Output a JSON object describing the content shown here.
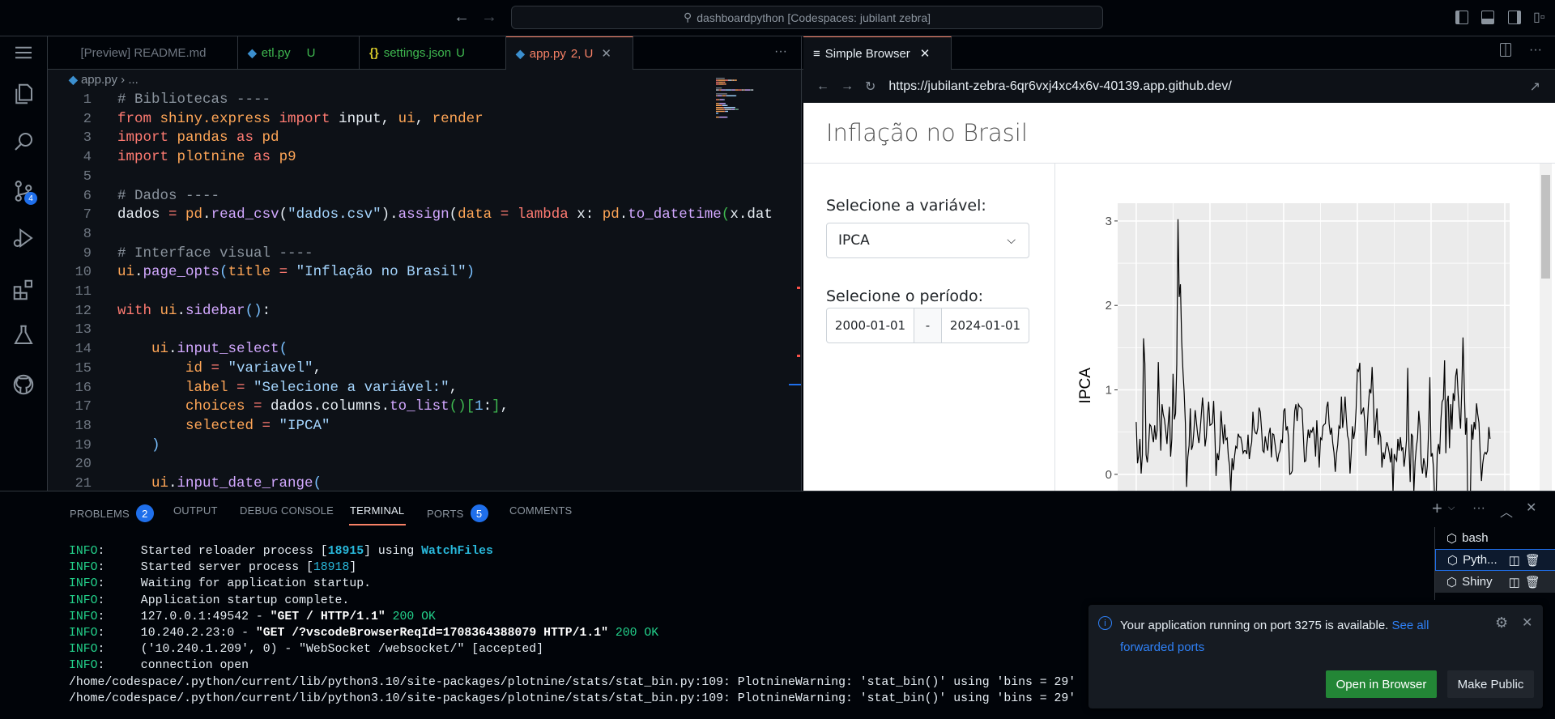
{
  "titlebar": {
    "search": "dashboardpython [Codespaces: jubilant zebra]"
  },
  "activity": {
    "source_control_badge": "4"
  },
  "tabs": [
    {
      "label": "[Preview] README.md",
      "status": ""
    },
    {
      "label": "etl.py",
      "status": "U"
    },
    {
      "label": "settings.json",
      "status": "U"
    },
    {
      "label": "app.py",
      "status": "2, U"
    }
  ],
  "tabs_more": "···",
  "breadcrumb": {
    "file": "app.py",
    "rest": "..."
  },
  "code": [
    [
      [
        "# Bibliotecas ----",
        "cm"
      ]
    ],
    [
      [
        "from",
        "kw"
      ],
      [
        " shiny.express ",
        "mo"
      ],
      [
        "import",
        "kw"
      ],
      [
        " input, ",
        "w"
      ],
      [
        "ui",
        "mo"
      ],
      [
        ", ",
        "w"
      ],
      [
        "render",
        "mo"
      ]
    ],
    [
      [
        "import",
        "kw"
      ],
      [
        " pandas ",
        "mo"
      ],
      [
        "as",
        "kw"
      ],
      [
        " pd",
        "mo"
      ]
    ],
    [
      [
        "import",
        "kw"
      ],
      [
        " plotnine ",
        "mo"
      ],
      [
        "as",
        "kw"
      ],
      [
        " p9",
        "mo"
      ]
    ],
    [],
    [
      [
        "# Dados ----",
        "cm"
      ]
    ],
    [
      [
        "dados ",
        "w"
      ],
      [
        "= ",
        "kw"
      ],
      [
        "pd",
        "mo"
      ],
      [
        ".",
        "w"
      ],
      [
        "read_csv",
        "fn"
      ],
      [
        "(",
        "w"
      ],
      [
        "\"dados.csv\"",
        "st"
      ],
      [
        ").",
        "w"
      ],
      [
        "assign",
        "fn"
      ],
      [
        "(",
        "w"
      ],
      [
        "data ",
        "mo"
      ],
      [
        "= ",
        "kw"
      ],
      [
        "lambda",
        "kw"
      ],
      [
        " x: ",
        "w"
      ],
      [
        "pd",
        "mo"
      ],
      [
        ".",
        "w"
      ],
      [
        "to_datetime",
        "fn"
      ],
      [
        "(",
        "gr"
      ],
      [
        "x.dat",
        "w"
      ]
    ],
    [],
    [
      [
        "# Interface visual ----",
        "cm"
      ]
    ],
    [
      [
        "ui",
        "mo"
      ],
      [
        ".",
        "w"
      ],
      [
        "page_opts",
        "fn"
      ],
      [
        "(",
        "bl"
      ],
      [
        "title ",
        "mo"
      ],
      [
        "= ",
        "kw"
      ],
      [
        "\"Inflação no Brasil\"",
        "st"
      ],
      [
        ")",
        "bl"
      ]
    ],
    [],
    [
      [
        "with",
        "kw"
      ],
      [
        " ui",
        "mo"
      ],
      [
        ".",
        "w"
      ],
      [
        "sidebar",
        "fn"
      ],
      [
        "()",
        "bl"
      ],
      [
        ":",
        "w"
      ]
    ],
    [],
    [
      [
        "    ui",
        "mo"
      ],
      [
        ".",
        "w"
      ],
      [
        "input_select",
        "fn"
      ],
      [
        "(",
        "bl"
      ]
    ],
    [
      [
        "        id ",
        "mo"
      ],
      [
        "= ",
        "kw"
      ],
      [
        "\"variavel\"",
        "st"
      ],
      [
        ",",
        "w"
      ]
    ],
    [
      [
        "        label ",
        "mo"
      ],
      [
        "= ",
        "kw"
      ],
      [
        "\"Selecione a variável:\"",
        "st"
      ],
      [
        ",",
        "w"
      ]
    ],
    [
      [
        "        choices ",
        "mo"
      ],
      [
        "= ",
        "kw"
      ],
      [
        "dados.columns.",
        "w"
      ],
      [
        "to_list",
        "fn"
      ],
      [
        "()",
        "gr"
      ],
      [
        "[",
        "gr"
      ],
      [
        "1",
        "bl"
      ],
      [
        ":",
        "w"
      ],
      [
        "]",
        "gr"
      ],
      [
        ",",
        "w"
      ]
    ],
    [
      [
        "        selected ",
        "mo"
      ],
      [
        "= ",
        "kw"
      ],
      [
        "\"IPCA\"",
        "st"
      ]
    ],
    [
      [
        "    )",
        "bl"
      ]
    ],
    [],
    [
      [
        "    ui",
        "mo"
      ],
      [
        ".",
        "w"
      ],
      [
        "input_date_range",
        "fn"
      ],
      [
        "(",
        "bl"
      ]
    ]
  ],
  "browser": {
    "tab_label": "Simple Browser",
    "url": "https://jubilant-zebra-6qr6vxj4xc4x6v-40139.app.github.dev/",
    "page_title": "Inflação no Brasil",
    "select_label": "Selecione a variável:",
    "select_value": "IPCA",
    "period_label": "Selecione o período:",
    "date_start": "2000-01-01",
    "date_sep": "-",
    "date_end": "2024-01-01"
  },
  "chart_data": {
    "type": "line",
    "title": "",
    "xlabel": "",
    "ylabel": "IPCA",
    "x_start": "2000-01",
    "x_step": "month",
    "xlim": [
      1998.74,
      2025.33
    ],
    "ylim": [
      -0.85,
      3.21
    ],
    "yticks": [
      0,
      1,
      2,
      3
    ],
    "ytick_labels": [
      "0",
      "1",
      "2",
      "3"
    ],
    "grid": true,
    "values": [
      0.62,
      0.13,
      0.22,
      0.42,
      0.01,
      0.23,
      1.61,
      1.31,
      0.23,
      0.14,
      0.32,
      0.59,
      0.57,
      0.46,
      0.38,
      0.58,
      0.41,
      0.52,
      1.33,
      0.7,
      0.28,
      0.83,
      0.71,
      0.65,
      0.52,
      0.36,
      0.6,
      0.8,
      0.21,
      0.42,
      1.19,
      0.65,
      0.72,
      1.31,
      3.02,
      2.1,
      2.25,
      1.57,
      1.23,
      0.97,
      0.61,
      -0.15,
      0.2,
      0.34,
      0.78,
      0.29,
      0.34,
      0.52,
      0.76,
      0.61,
      0.47,
      0.37,
      0.51,
      0.71,
      0.91,
      0.69,
      0.33,
      0.44,
      0.69,
      0.86,
      0.58,
      0.59,
      0.61,
      0.87,
      0.49,
      -0.02,
      0.25,
      0.17,
      0.35,
      0.75,
      0.55,
      0.36,
      0.59,
      0.41,
      0.43,
      0.21,
      0.1,
      -0.21,
      0.19,
      0.05,
      0.21,
      0.33,
      0.31,
      0.48,
      0.44,
      0.44,
      0.37,
      0.25,
      0.28,
      0.28,
      0.24,
      0.47,
      0.18,
      0.3,
      0.38,
      0.74,
      0.54,
      0.49,
      0.48,
      0.55,
      0.79,
      0.74,
      0.53,
      0.28,
      0.26,
      0.45,
      0.36,
      0.28,
      0.48,
      0.55,
      0.2,
      0.48,
      0.47,
      0.36,
      0.24,
      0.15,
      0.24,
      0.28,
      0.41,
      0.37,
      0.75,
      0.78,
      0.52,
      0.57,
      0.43,
      0.0,
      0.01,
      0.04,
      0.45,
      0.75,
      0.83,
      0.63,
      0.83,
      0.8,
      0.79,
      0.77,
      0.47,
      0.15,
      0.16,
      0.37,
      0.53,
      0.43,
      0.52,
      0.5,
      0.56,
      0.45,
      0.21,
      0.64,
      0.36,
      0.08,
      0.43,
      0.41,
      0.57,
      0.59,
      0.6,
      0.79,
      0.86,
      0.6,
      0.47,
      0.55,
      0.37,
      0.26,
      0.03,
      0.24,
      0.35,
      0.57,
      0.54,
      0.92,
      0.55,
      0.69,
      0.92,
      0.67,
      0.46,
      0.4,
      0.01,
      0.25,
      0.57,
      0.42,
      0.51,
      0.78,
      1.24,
      1.22,
      1.32,
      0.71,
      0.74,
      0.79,
      0.62,
      0.22,
      0.54,
      0.82,
      1.01,
      0.96,
      1.27,
      0.9,
      0.43,
      0.61,
      0.78,
      0.35,
      0.52,
      0.44,
      0.08,
      0.26,
      0.18,
      0.3,
      0.38,
      0.33,
      0.25,
      0.14,
      0.31,
      -0.23,
      0.24,
      0.19,
      0.16,
      0.42,
      0.28,
      0.44,
      0.29,
      0.32,
      0.09,
      0.22,
      0.4,
      1.26,
      0.33,
      -0.09,
      0.48,
      0.45,
      -0.21,
      0.15,
      0.32,
      0.43,
      0.75,
      0.57,
      0.13,
      0.01,
      0.19,
      0.11,
      -0.04,
      0.1,
      0.51,
      1.15,
      0.21,
      0.25,
      0.07,
      -0.31,
      -0.38,
      0.26,
      0.36,
      0.24,
      0.64,
      0.86,
      0.89,
      1.35,
      0.25,
      0.86,
      0.93,
      0.31,
      0.83,
      0.53,
      0.96,
      0.87,
      1.16,
      1.25,
      0.95,
      0.73,
      0.54,
      1.01,
      1.62,
      1.06,
      0.47,
      0.67,
      -0.68,
      -0.36,
      -0.29,
      0.59,
      0.41,
      0.62,
      0.53,
      0.84,
      0.71,
      0.61,
      0.23,
      -0.08,
      0.12,
      0.23,
      0.26,
      0.24,
      0.28,
      0.56,
      0.42
    ]
  },
  "panel": {
    "tabs": [
      {
        "label": "PROBLEMS",
        "badge": "2"
      },
      {
        "label": "OUTPUT",
        "badge": ""
      },
      {
        "label": "DEBUG CONSOLE",
        "badge": ""
      },
      {
        "label": "TERMINAL",
        "badge": ""
      },
      {
        "label": "PORTS",
        "badge": "5"
      },
      {
        "label": "COMMENTS",
        "badge": ""
      }
    ],
    "terminal": [
      [
        [
          "INFO",
          "tg"
        ],
        [
          ":     Started reloader process [",
          "w"
        ],
        [
          "18915",
          "tcb"
        ],
        [
          "] using ",
          "w"
        ],
        [
          "WatchFiles",
          "tcb"
        ]
      ],
      [
        [
          "INFO",
          "tg"
        ],
        [
          ":     Started server process [",
          "w"
        ],
        [
          "18918",
          "tc"
        ],
        [
          "]",
          "w"
        ]
      ],
      [
        [
          "INFO",
          "tg"
        ],
        [
          ":     Waiting for application startup.",
          "w"
        ]
      ],
      [
        [
          "INFO",
          "tg"
        ],
        [
          ":     Application startup complete.",
          "w"
        ]
      ],
      [
        [
          "INFO",
          "tg"
        ],
        [
          ":     127.0.0.1:49542 - ",
          "w"
        ],
        [
          "\"GET / HTTP/1.1\"",
          "tb"
        ],
        [
          " 200 OK",
          "tg"
        ]
      ],
      [
        [
          "INFO",
          "tg"
        ],
        [
          ":     10.240.2.23:0 - ",
          "w"
        ],
        [
          "\"GET /?vscodeBrowserReqId=1708364388079 HTTP/1.1\"",
          "tb"
        ],
        [
          " 200 OK",
          "tg"
        ]
      ],
      [
        [
          "INFO",
          "tg"
        ],
        [
          ":     ('10.240.1.209', 0) - \"WebSocket /websocket/\" [accepted]",
          "w"
        ]
      ],
      [
        [
          "INFO",
          "tg"
        ],
        [
          ":     connection open",
          "w"
        ]
      ],
      [
        [
          "/home/codespace/.python/current/lib/python3.10/site-packages/plotnine/stats/stat_bin.py:109: PlotnineWarning: 'stat_bin()' using 'bins = 29'",
          "w"
        ]
      ],
      [
        [
          "/home/codespace/.python/current/lib/python3.10/site-packages/plotnine/stats/stat_bin.py:109: PlotnineWarning: 'stat_bin()' using 'bins = 29'",
          "w"
        ]
      ]
    ],
    "terminals": [
      "bash",
      "Pyth...",
      "Shiny"
    ]
  },
  "notification": {
    "message": "Your application running on port 3275 is available.",
    "link": "See all forwarded ports",
    "primary": "Open in Browser",
    "secondary": "Make Public"
  }
}
